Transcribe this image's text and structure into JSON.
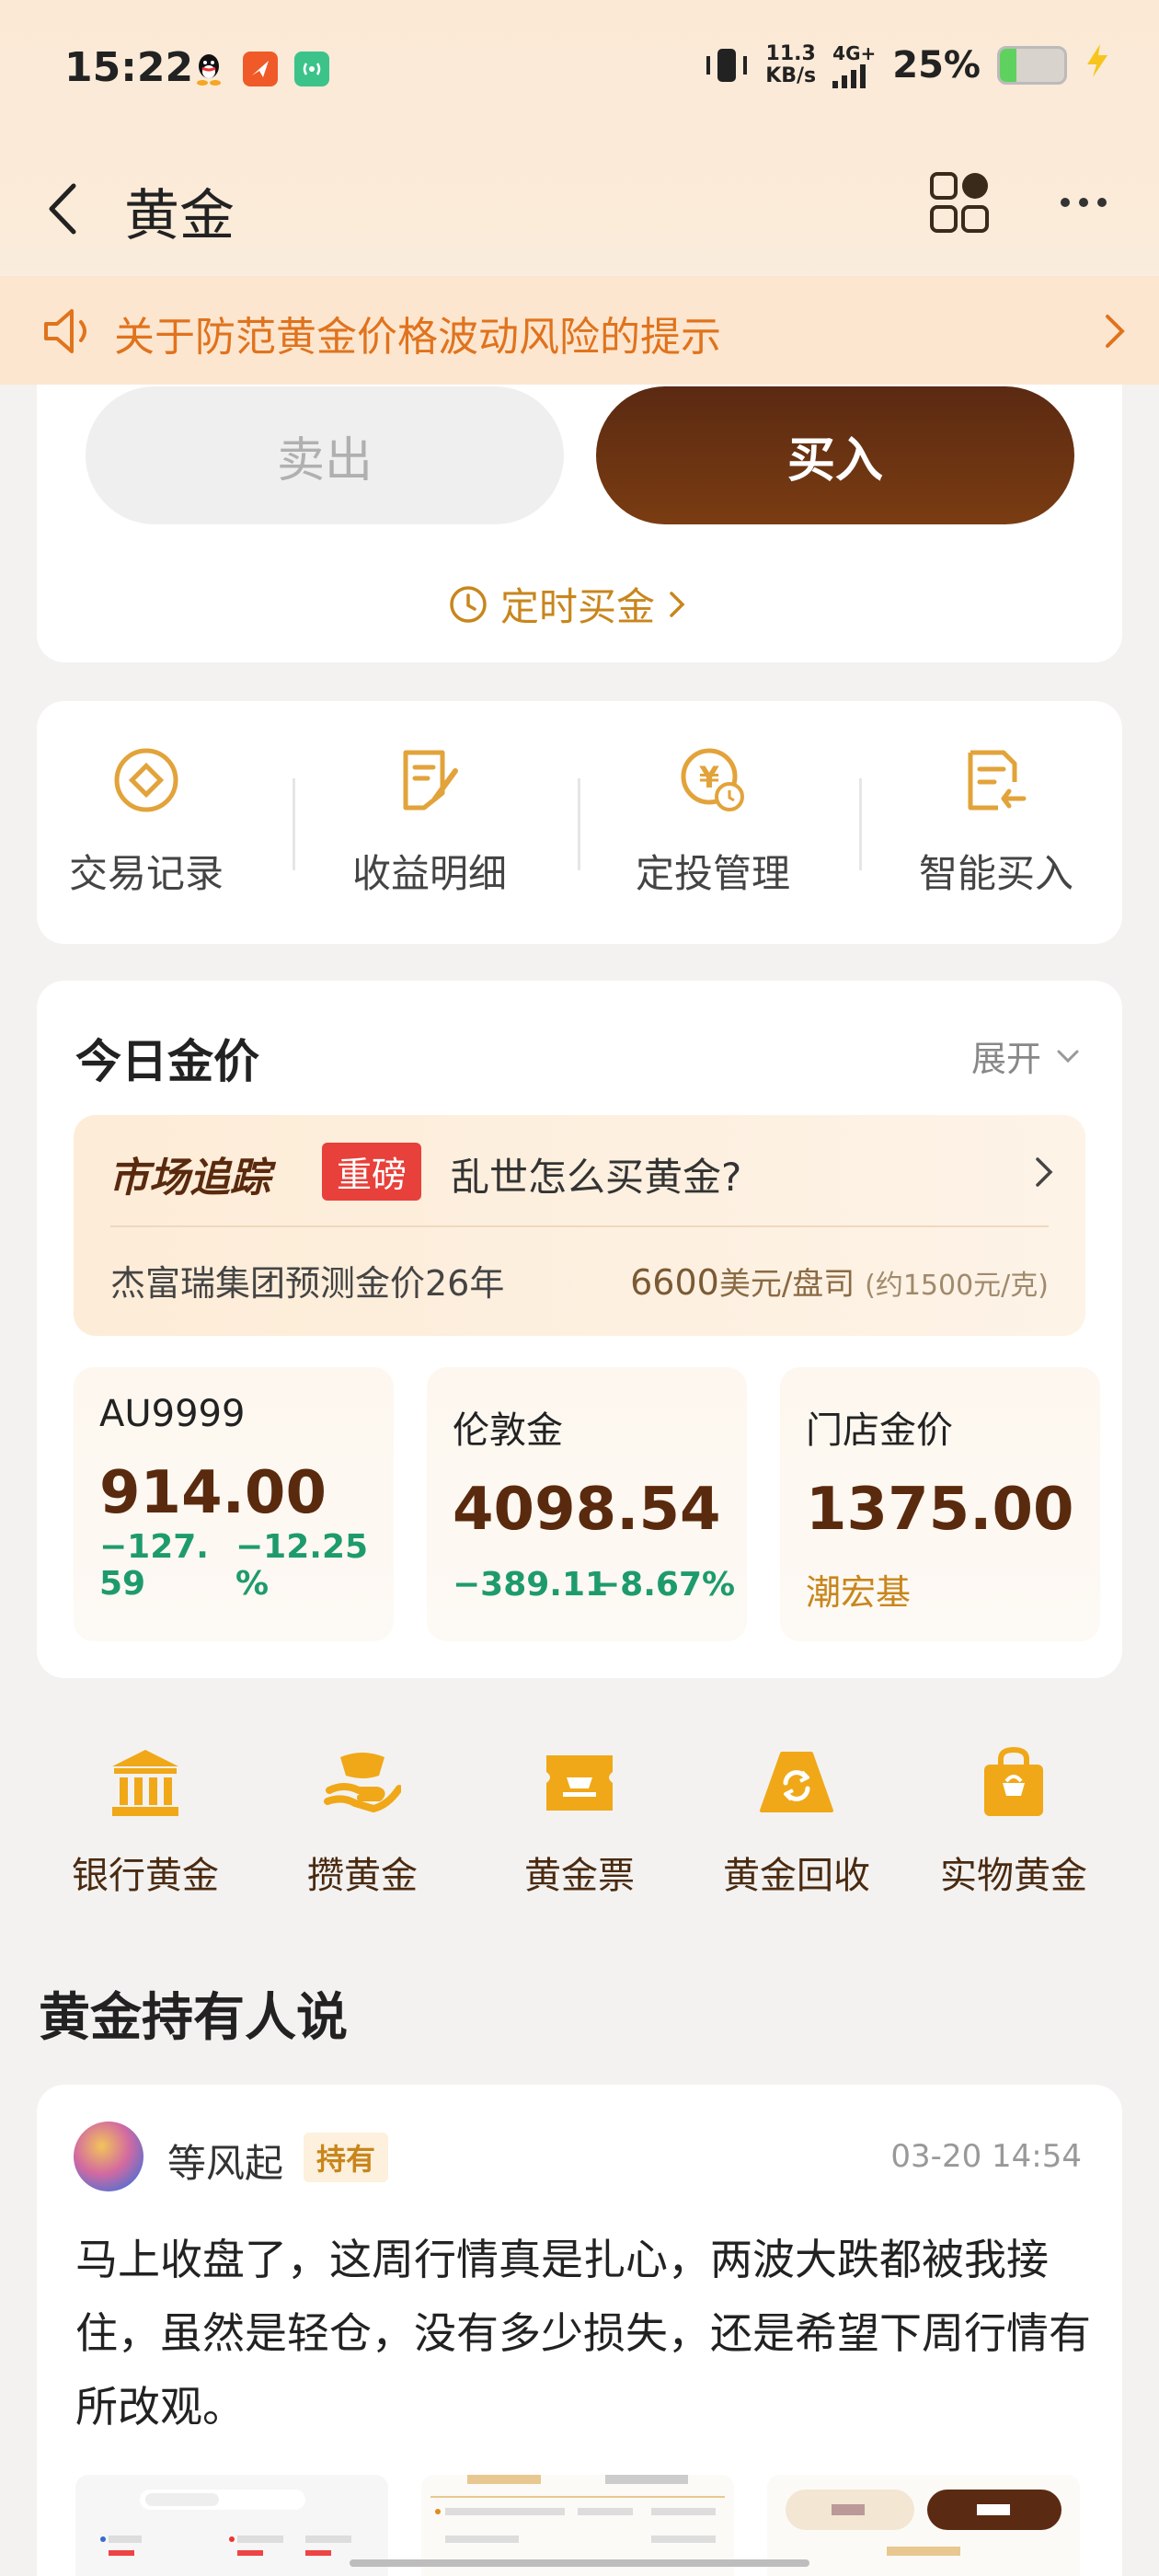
{
  "status_bar": {
    "time": "15:22",
    "net_speed_value": "11.3",
    "net_speed_unit": "KB/s",
    "network": "4G+",
    "battery_percent": "25%",
    "battery_level": 0.25,
    "icons": [
      "qq-icon",
      "orange-app-icon",
      "green-app-icon",
      "vibrate-icon",
      "signal-icon",
      "battery-icon",
      "charging-bolt-icon"
    ]
  },
  "nav": {
    "title": "黄金",
    "icons": [
      "back-icon",
      "grid-icon",
      "more-icon"
    ]
  },
  "notice": {
    "text": "关于防范黄金价格波动风险的提示"
  },
  "trade": {
    "sell_label": "卖出",
    "buy_label": "买入",
    "timed_buy_label": "定时买金"
  },
  "actions": [
    {
      "label": "交易记录",
      "icon": "record-icon"
    },
    {
      "label": "收益明细",
      "icon": "earnings-icon"
    },
    {
      "label": "定投管理",
      "icon": "fixed-invest-icon"
    },
    {
      "label": "智能买入",
      "icon": "smart-buy-icon"
    }
  ],
  "today": {
    "title": "今日金价",
    "expand_label": "展开",
    "banner": {
      "logo": "市场追踪",
      "badge": "重磅",
      "headline": "乱世怎么买黄金?",
      "subtitle": "杰富瑞集团预测金价26年",
      "price_value": "6600",
      "price_unit": "美元/盘司",
      "price_note": "(约1500元/克)"
    },
    "prices": [
      {
        "name": "AU9999",
        "value": "914.00",
        "change_line1": "−127.",
        "change_line2": "59",
        "pct_line1": "−12.25",
        "pct_line2": "%"
      },
      {
        "name": "伦敦金",
        "value": "4098.54",
        "change": "−389.11",
        "pct": "−8.67%"
      },
      {
        "name": "门店金价",
        "value": "1375.00",
        "brand": "潮宏基"
      }
    ]
  },
  "categories": [
    {
      "label": "银行黄金",
      "icon": "bank-icon"
    },
    {
      "label": "攒黄金",
      "icon": "ingot-hand-icon"
    },
    {
      "label": "黄金票",
      "icon": "ticket-icon"
    },
    {
      "label": "黄金回收",
      "icon": "recycle-icon"
    },
    {
      "label": "实物黄金",
      "icon": "shopping-bag-icon"
    }
  ],
  "holders": {
    "title": "黄金持有人说",
    "post": {
      "user": "等风起",
      "badge": "持有",
      "time": "03-20 14:54",
      "text": "马上收盘了，这周行情真是扎心，两波大跌都被我接住，虽然是轻仓，没有多少损失，还是希望下周行情有所改观。"
    }
  },
  "colors": {
    "accent_gold": "#c8861c",
    "buy_brown": "#5b2a12",
    "down_green": "#1e9b6c",
    "notice_orange": "#e0731d"
  }
}
